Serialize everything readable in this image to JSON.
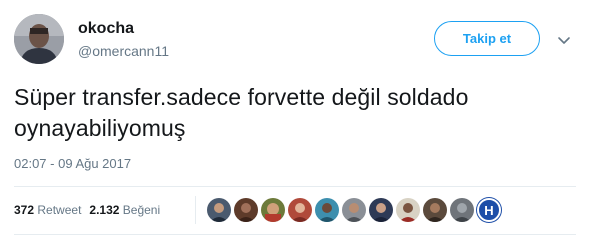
{
  "user": {
    "display_name": "okocha",
    "handle": "@omercann11"
  },
  "follow_button_label": "Takip et",
  "tweet_text": "Süper transfer.sadece forvette değil soldado oynayabiliyomuş",
  "timestamp": "02:07 - 09 Ağu 2017",
  "stats": {
    "retweet_count": "372",
    "retweet_label": "Retweet",
    "like_count": "2.132",
    "like_label": "Beğeni"
  },
  "liker_last_initial": "H",
  "colors": {
    "accent": "#1da1f2",
    "text": "#14171a",
    "muted": "#657786",
    "divider": "#e6ecf0"
  },
  "icons": [
    "chevron-down-icon"
  ]
}
